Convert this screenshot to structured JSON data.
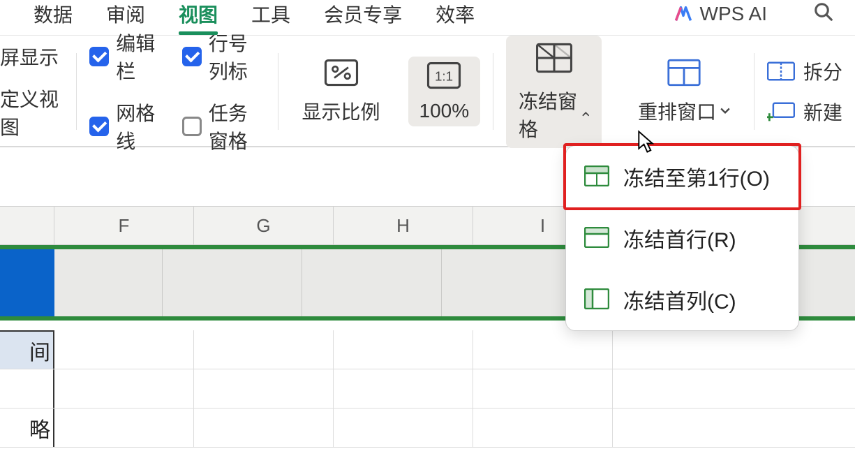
{
  "menu": {
    "items": [
      "数据",
      "审阅",
      "视图",
      "工具",
      "会员专享",
      "效率"
    ],
    "active_index": 2,
    "wps_ai_label": "WPS AI"
  },
  "ribbon": {
    "left_partial": [
      "屏显示",
      "定义视图"
    ],
    "checks": {
      "editbar": {
        "label": "编辑栏",
        "checked": true
      },
      "rowcolnum": {
        "label": "行号列标",
        "checked": true
      },
      "gridlines": {
        "label": "网格线",
        "checked": true
      },
      "taskpane": {
        "label": "任务窗格",
        "checked": false
      }
    },
    "zoom_ratio_label": "显示比例",
    "zoom_100_label": "100%",
    "freeze_label": "冻结窗格",
    "rearrange_label": "重排窗口",
    "right_partial": {
      "split": "拆分",
      "new": "新建"
    }
  },
  "dropdown": {
    "items": [
      {
        "label": "冻结至第1行(O)",
        "highlighted": true
      },
      {
        "label": "冻结首行(R)",
        "highlighted": false
      },
      {
        "label": "冻结首列(C)",
        "highlighted": false
      }
    ]
  },
  "sheet": {
    "columns": [
      "F",
      "G",
      "H",
      "I"
    ],
    "rowA_labels": [
      "间",
      "",
      "略"
    ]
  }
}
